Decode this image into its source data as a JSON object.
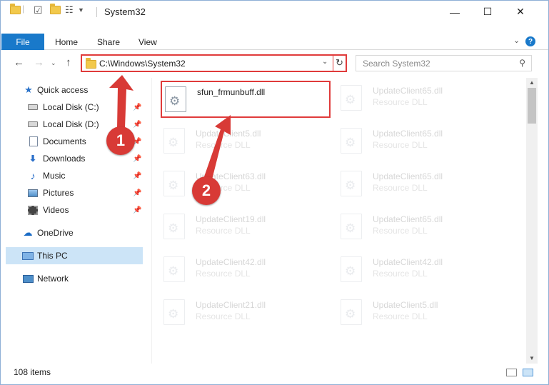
{
  "window": {
    "title": "System32"
  },
  "ribbon": {
    "tabs": [
      "File",
      "Home",
      "Share",
      "View"
    ],
    "help": "?"
  },
  "nav": {
    "address": "C:\\Windows\\System32",
    "search_placeholder": "Search System32"
  },
  "sidebar": {
    "items": [
      {
        "label": "Quick access",
        "icon": "star-icon",
        "pinned": false
      },
      {
        "label": "Local Disk (C:)",
        "icon": "drive-icon",
        "pinned": true
      },
      {
        "label": "Local Disk (D:)",
        "icon": "drive-icon",
        "pinned": true
      },
      {
        "label": "Documents",
        "icon": "document-icon",
        "pinned": true
      },
      {
        "label": "Downloads",
        "icon": "download-icon",
        "pinned": true
      },
      {
        "label": "Music",
        "icon": "music-icon",
        "pinned": true
      },
      {
        "label": "Pictures",
        "icon": "pictures-icon",
        "pinned": true
      },
      {
        "label": "Videos",
        "icon": "videos-icon",
        "pinned": true
      },
      {
        "label": "OneDrive",
        "icon": "cloud-icon",
        "pinned": false
      },
      {
        "label": "This PC",
        "icon": "computer-icon",
        "pinned": false,
        "selected": true
      },
      {
        "label": "Network",
        "icon": "network-icon",
        "pinned": false
      }
    ]
  },
  "files": [
    {
      "name": "sfun_frmunbuff.dll",
      "type": "",
      "highlighted": true
    },
    {
      "name": "UpdateClient65.dll",
      "type": "Resource DLL",
      "faded": true
    },
    {
      "name": "UpdateClient5.dll",
      "type": "Resource DLL",
      "faded": true
    },
    {
      "name": "UpdateClient65.dll",
      "type": "Resource DLL",
      "faded": true
    },
    {
      "name": "UpdateClient63.dll",
      "type": "Resource DLL",
      "faded": true
    },
    {
      "name": "UpdateClient65.dll",
      "type": "Resource DLL",
      "faded": true
    },
    {
      "name": "UpdateClient19.dll",
      "type": "Resource DLL",
      "faded": true
    },
    {
      "name": "UpdateClient65.dll",
      "type": "Resource DLL",
      "faded": true
    },
    {
      "name": "UpdateClient42.dll",
      "type": "Resource DLL",
      "faded": true
    },
    {
      "name": "UpdateClient42.dll",
      "type": "Resource DLL",
      "faded": true
    },
    {
      "name": "UpdateClient21.dll",
      "type": "Resource DLL",
      "faded": true
    },
    {
      "name": "UpdateClient5.dll",
      "type": "Resource DLL",
      "faded": true
    }
  ],
  "status": {
    "items": "108 items"
  },
  "annotations": {
    "step1": "1",
    "step2": "2"
  },
  "colors": {
    "accent": "#1979ca",
    "highlight": "#e03b3b",
    "callout": "#d83a36",
    "selected": "#cce4f7"
  }
}
